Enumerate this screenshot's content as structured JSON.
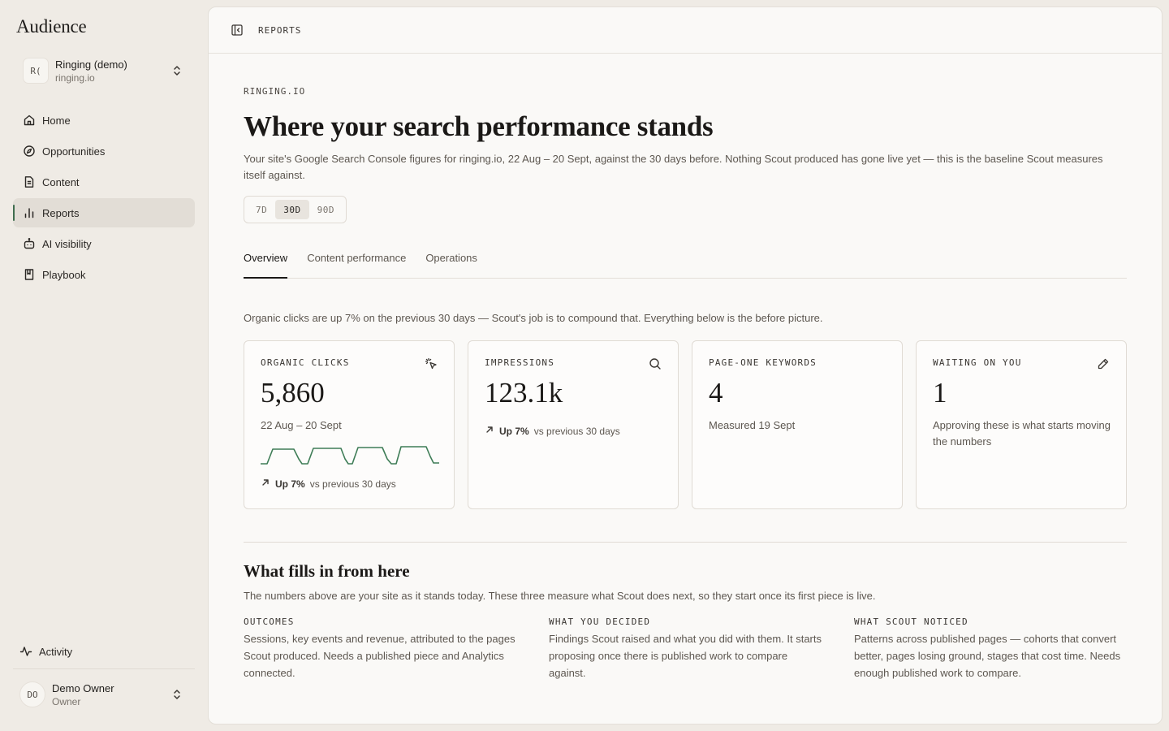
{
  "app": {
    "title": "Audience"
  },
  "workspace": {
    "initials": "R(",
    "name": "Ringing (demo)",
    "domain": "ringing.io"
  },
  "nav": {
    "items": [
      {
        "label": "Home",
        "icon": "home-icon"
      },
      {
        "label": "Opportunities",
        "icon": "compass-icon"
      },
      {
        "label": "Content",
        "icon": "document-icon"
      },
      {
        "label": "Reports",
        "icon": "bar-chart-icon",
        "active": true
      },
      {
        "label": "AI visibility",
        "icon": "bot-icon"
      },
      {
        "label": "Playbook",
        "icon": "book-icon"
      }
    ],
    "activity": "Activity"
  },
  "user": {
    "initials": "DO",
    "name": "Demo Owner",
    "role": "Owner"
  },
  "header": {
    "breadcrumb": "REPORTS"
  },
  "page": {
    "eyebrow": "RINGING.IO",
    "title": "Where your search performance stands",
    "subtitle": "Your site's Google Search Console figures for ringing.io, 22 Aug – 20 Sept, against the 30 days before. Nothing Scout produced has gone live yet — this is the baseline Scout measures itself against.",
    "ranges": [
      "7D",
      "30D",
      "90D"
    ],
    "selected_range": "30D",
    "tabs": [
      "Overview",
      "Content performance",
      "Operations"
    ],
    "active_tab": "Overview",
    "lead": "Organic clicks are up 7% on the previous 30 days — Scout's job is to compound that. Everything below is the before picture."
  },
  "cards": [
    {
      "label": "ORGANIC CLICKS",
      "icon": "cursor-click-icon",
      "value": "5,860",
      "note": "22 Aug – 20 Sept",
      "delta": "Up 7%",
      "delta_note": "vs previous 30 days",
      "accent": "#3f7d57"
    },
    {
      "label": "IMPRESSIONS",
      "icon": "search-icon",
      "value": "123.1k",
      "delta": "Up 7%",
      "delta_note": "vs previous 30 days"
    },
    {
      "label": "PAGE-ONE KEYWORDS",
      "value": "4",
      "note": "Measured 19 Sept"
    },
    {
      "label": "WAITING ON YOU",
      "icon": "pencil-icon",
      "value": "1",
      "note": "Approving these is what starts moving the numbers"
    }
  ],
  "fills": {
    "title": "What fills in from here",
    "subtitle": "The numbers above are your site as it stands today. These three measure what Scout does next, so they start once its first piece is live.",
    "columns": [
      {
        "label": "OUTCOMES",
        "text": "Sessions, key events and revenue, attributed to the pages Scout produced. Needs a published piece and Analytics connected."
      },
      {
        "label": "WHAT YOU DECIDED",
        "text": "Findings Scout raised and what you did with them. It starts proposing once there is published work to compare against."
      },
      {
        "label": "WHAT SCOUT NOTICED",
        "text": "Patterns across published pages — cohorts that convert better, pages losing ground, stages that cost time. Needs enough published work to compare."
      }
    ]
  }
}
